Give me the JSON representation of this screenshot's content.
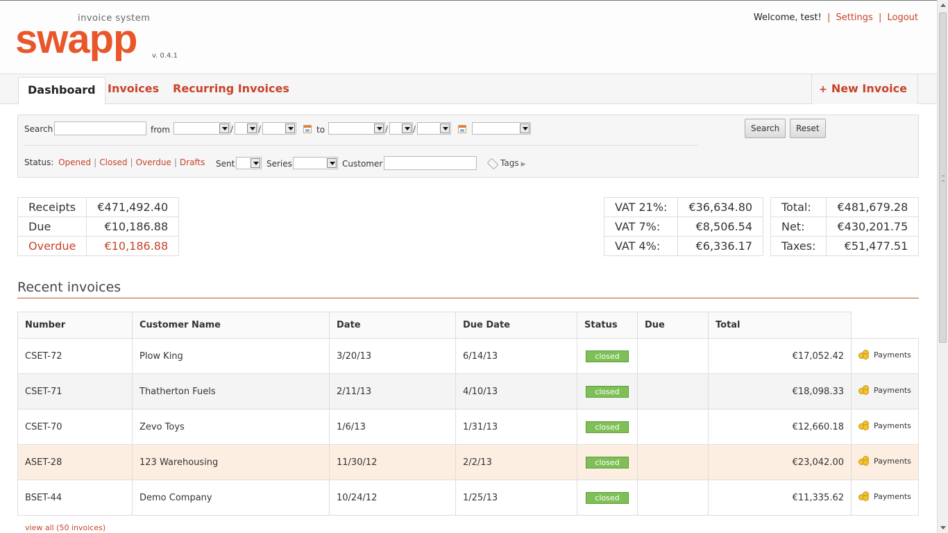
{
  "header": {
    "logo_text": "swapp",
    "logo_subtitle": "invoice system",
    "version": "v. 0.4.1",
    "welcome": "Welcome, test!",
    "settings": "Settings",
    "logout": "Logout"
  },
  "nav": {
    "tabs": [
      {
        "label": "Dashboard"
      },
      {
        "label": "Invoices"
      },
      {
        "label": "Recurring Invoices"
      }
    ],
    "new_invoice": "New Invoice"
  },
  "search": {
    "search_label": "Search",
    "from_label": "from",
    "to_label": "to",
    "search_button": "Search",
    "reset_button": "Reset",
    "status_label": "Status:",
    "statuses": [
      "Opened",
      "Closed",
      "Overdue",
      "Drafts"
    ],
    "sent_label": "Sent",
    "series_label": "Series",
    "customer_label": "Customer",
    "tags_label": "Tags"
  },
  "summary": {
    "receipts_label": "Receipts",
    "receipts": "€471,492.40",
    "due_label": "Due",
    "due": "€10,186.88",
    "overdue_label": "Overdue",
    "overdue": "€10,186.88",
    "vat": [
      {
        "label": "VAT 21%:",
        "value": "€36,634.80"
      },
      {
        "label": "VAT 7%:",
        "value": "€8,506.54"
      },
      {
        "label": "VAT 4%:",
        "value": "€6,336.17"
      }
    ],
    "totals": [
      {
        "label": "Total:",
        "value": "€481,679.28"
      },
      {
        "label": "Net:",
        "value": "€430,201.75"
      },
      {
        "label": "Taxes:",
        "value": "€51,477.51"
      }
    ]
  },
  "recent": {
    "title": "Recent invoices",
    "columns": [
      "Number",
      "Customer Name",
      "Date",
      "Due Date",
      "Status",
      "Due",
      "Total"
    ],
    "rows": [
      {
        "number": "CSET-72",
        "customer": "Plow King",
        "date": "3/20/13",
        "due_date": "6/14/13",
        "status": "closed",
        "due": "",
        "total": "€17,052.42",
        "action": "Payments"
      },
      {
        "number": "CSET-71",
        "customer": "Thatherton Fuels",
        "date": "2/11/13",
        "due_date": "4/10/13",
        "status": "closed",
        "due": "",
        "total": "€18,098.33",
        "action": "Payments"
      },
      {
        "number": "CSET-70",
        "customer": "Zevo Toys",
        "date": "1/6/13",
        "due_date": "1/31/13",
        "status": "closed",
        "due": "",
        "total": "€12,660.18",
        "action": "Payments"
      },
      {
        "number": "ASET-28",
        "customer": "123 Warehousing",
        "date": "11/30/12",
        "due_date": "2/2/13",
        "status": "closed",
        "due": "",
        "total": "€23,042.00",
        "action": "Payments"
      },
      {
        "number": "BSET-44",
        "customer": "Demo Company",
        "date": "10/24/12",
        "due_date": "1/25/13",
        "status": "closed",
        "due": "",
        "total": "€11,335.62",
        "action": "Payments"
      }
    ],
    "view_all": "view all (50 invoices)"
  },
  "colors": {
    "brand": "#e8562a",
    "link": "#c8432a",
    "status_closed": "#7ec057",
    "highlight_row": "#fdeee2"
  }
}
